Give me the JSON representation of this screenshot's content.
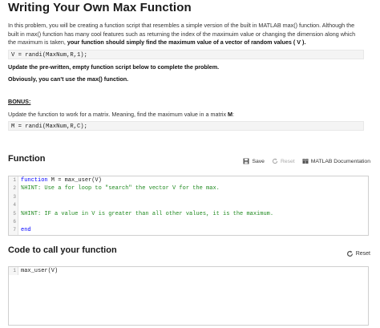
{
  "page": {
    "title": "Writing Your Own Max Function",
    "intro_part1": "In this problem, you will be creating a function script that resembles a simple version of the built in MATLAB max() function. Although the built in max() function has many cool features such as returning the index of the maximuim value or changing the dimension along which the maximum is taken, ",
    "intro_bold": "your function should simply find the maximum value of a vector of random values ( V ).",
    "code1": "V = randi(MaxNum,R,1);",
    "instruction1": "Update the pre-written, empty function script below to complete the problem.",
    "instruction2": "Obviously, you can't use the max() function.",
    "bonus_label": "BONUS:",
    "bonus_text_pre": "Update the function to work for a matrix. Meaning, find the maximum value in a matrix ",
    "bonus_text_bold": "M",
    "bonus_text_post": ":",
    "code2": "M = randi(MaxNum,R,C);"
  },
  "function_section": {
    "heading": "Function",
    "save_label": "Save",
    "reset_label": "Reset",
    "docs_label": "MATLAB Documentation",
    "lines": [
      {
        "num": "1",
        "kw": "function",
        "rest": " M = max_user(V)",
        "comment": ""
      },
      {
        "num": "2",
        "kw": "",
        "rest": "",
        "comment": "%HINT: Use a for loop to \"search\" the vector V for the max."
      },
      {
        "num": "3",
        "kw": "",
        "rest": "",
        "comment": ""
      },
      {
        "num": "4",
        "kw": "",
        "rest": "",
        "comment": ""
      },
      {
        "num": "5",
        "kw": "",
        "rest": "",
        "comment": "%HINT: IF a value in V is greater than all other values, it is the maximum."
      },
      {
        "num": "6",
        "kw": "",
        "rest": "",
        "comment": ""
      },
      {
        "num": "7",
        "kw": "end",
        "rest": "",
        "comment": ""
      }
    ]
  },
  "call_section": {
    "heading": "Code to call your function",
    "reset_label": "Reset",
    "lines": [
      {
        "num": "1",
        "code": "max_user(V)"
      }
    ]
  }
}
